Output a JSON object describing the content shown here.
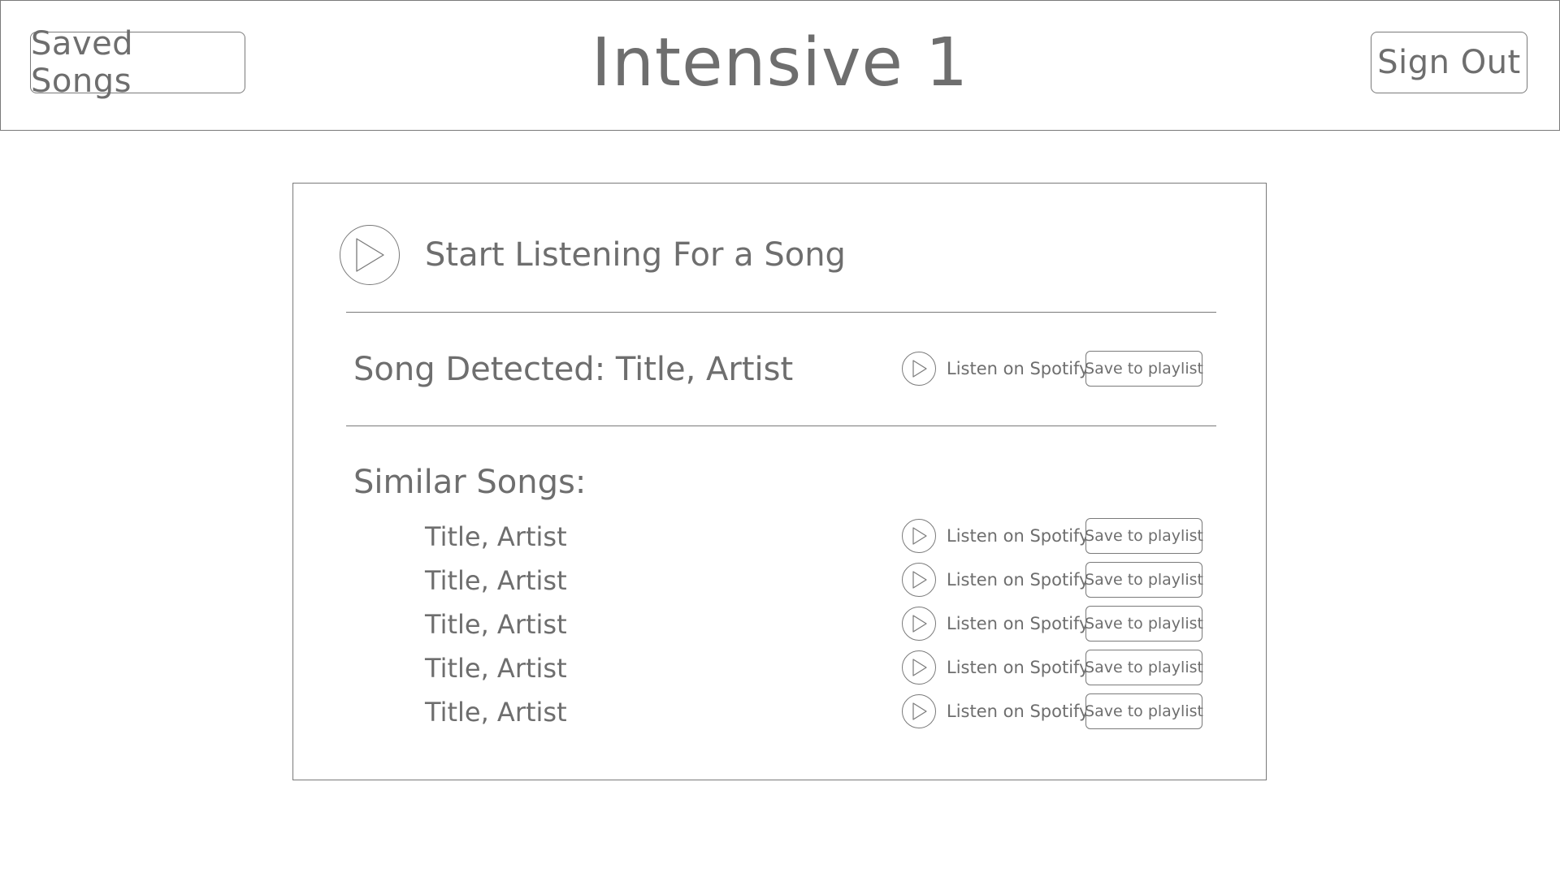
{
  "header": {
    "saved_songs_label": "Saved Songs",
    "title": "Intensive 1",
    "sign_out_label": "Sign Out"
  },
  "listen": {
    "label": "Start Listening For a Song"
  },
  "detected": {
    "text": "Song Detected: Title, Artist",
    "spotify_label": "Listen on Spotify",
    "save_label": "Save to playlist"
  },
  "similar": {
    "heading": "Similar Songs:",
    "songs": [
      {
        "title": "Title, Artist",
        "spotify_label": "Listen on Spotify",
        "save_label": "Save to playlist"
      },
      {
        "title": "Title, Artist",
        "spotify_label": "Listen on Spotify",
        "save_label": "Save to playlist"
      },
      {
        "title": "Title, Artist",
        "spotify_label": "Listen on Spotify",
        "save_label": "Save to playlist"
      },
      {
        "title": "Title, Artist",
        "spotify_label": "Listen on Spotify",
        "save_label": "Save to playlist"
      },
      {
        "title": "Title, Artist",
        "spotify_label": "Listen on Spotify",
        "save_label": "Save to playlist"
      }
    ]
  },
  "icons": {
    "play": "play-icon"
  },
  "colors": {
    "stroke": "#7a7a7a",
    "text": "#6e6e6e",
    "background": "#ffffff"
  }
}
